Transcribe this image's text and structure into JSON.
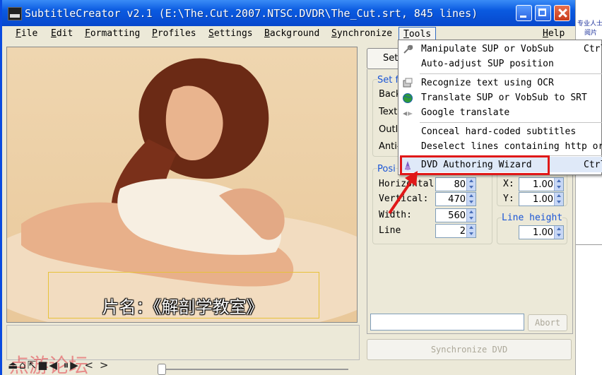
{
  "window": {
    "title": "SubtitleCreator v2.1 (E:\\The.Cut.2007.NTSC.DVDR\\The_Cut.srt, 845 lines)"
  },
  "menubar": {
    "items": [
      "File",
      "Edit",
      "Formatting",
      "Profiles",
      "Settings",
      "Background",
      "Synchronize",
      "Tools",
      "Help"
    ]
  },
  "video": {
    "subtitle_text": "片名：《解剖学教室》"
  },
  "playback": {
    "controls": "⏏⌂⇱■◀ ⏸▶ < >",
    "watermark": "点游论坛"
  },
  "panel": {
    "tab_label": "Set",
    "set_group": {
      "title": "Set fo",
      "rows": [
        "Backg",
        "Text",
        "Outlin",
        "Anti-a"
      ]
    },
    "position_group": {
      "title": "Posi",
      "fields": [
        {
          "label": "Horizontal",
          "value": "80"
        },
        {
          "label": "Vertical:",
          "value": "470"
        },
        {
          "label": "Width:",
          "value": "560"
        },
        {
          "label": "Line",
          "value": "2"
        }
      ]
    },
    "xy_group": {
      "fields": [
        {
          "label": "X:",
          "value": "1.00"
        },
        {
          "label": "Y:",
          "value": "1.00"
        }
      ]
    },
    "line_height": {
      "title": "Line height",
      "value": "1.00"
    },
    "abort_label": "Abort",
    "sync_label": "Synchronize DVD"
  },
  "tools_menu": {
    "items": [
      {
        "label": "Manipulate SUP or VobSub",
        "shortcut": "Ctrl"
      },
      {
        "label": "Auto-adjust SUP position",
        "shortcut": ""
      },
      {
        "label": "Recognize text using OCR",
        "shortcut": ""
      },
      {
        "label": "Translate SUP or VobSub to SRT",
        "shortcut": ""
      },
      {
        "label": "Google translate",
        "shortcut": ""
      },
      {
        "label": "Conceal hard-coded subtitles",
        "shortcut": ""
      },
      {
        "label": "Deselect lines containing http or",
        "shortcut": ""
      },
      {
        "label": "DVD Authoring Wizard",
        "shortcut": "Ctrl"
      }
    ]
  },
  "background_app": {
    "text1": "专业人士",
    "text2": "阅片"
  },
  "colors": {
    "titlebar": "#0a5ae0",
    "callout": "#e01818",
    "highlight": "#dfe9f8"
  }
}
